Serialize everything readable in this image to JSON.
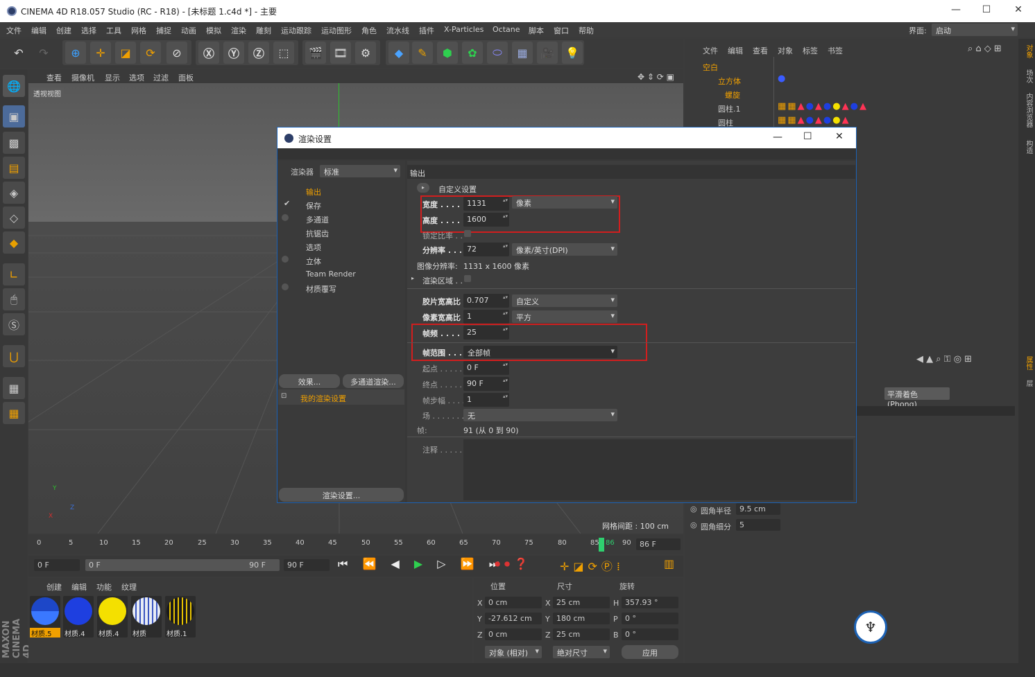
{
  "window": {
    "title": "CINEMA 4D R18.057 Studio (RC - R18) - [未标题 1.c4d *] - 主要",
    "controls": [
      "—",
      "☐",
      "✕"
    ]
  },
  "menu": {
    "items": [
      "文件",
      "编辑",
      "创建",
      "选择",
      "工具",
      "网格",
      "捕捉",
      "动画",
      "模拟",
      "渲染",
      "雕刻",
      "运动跟踪",
      "运动图形",
      "角色",
      "流水线",
      "插件",
      "X-Particles",
      "Octane",
      "脚本",
      "窗口",
      "帮助"
    ],
    "layout_label": "界面:",
    "layout_value": "启动"
  },
  "viewport": {
    "menu": [
      "查看",
      "摄像机",
      "显示",
      "选项",
      "过滤",
      "面板"
    ],
    "view_label": "透视视图",
    "grid_spacing": "网格间距 : 100 cm",
    "axis_y": "Y",
    "axis_z": "Z",
    "axis_x": "X"
  },
  "timeline": {
    "ticks": [
      "0",
      "5",
      "10",
      "15",
      "20",
      "25",
      "30",
      "35",
      "40",
      "45",
      "50",
      "55",
      "60",
      "65",
      "70",
      "75",
      "80",
      "85",
      "86",
      "90"
    ],
    "current_frame": "86 F",
    "start_field": "0 F",
    "range_start": "0 F",
    "range_end": "90 F",
    "end_field": "90 F"
  },
  "materials": {
    "menu": [
      "创建",
      "编辑",
      "功能",
      "纹理"
    ],
    "items": [
      {
        "label": "材质.5",
        "color": "#2a5bd7",
        "selected": true
      },
      {
        "label": "材质.4",
        "color": "#1e3fe0"
      },
      {
        "label": "材质.4",
        "color": "#f4e000"
      },
      {
        "label": "材质",
        "color": "#dfe4f0"
      },
      {
        "label": "材质.1",
        "color": "#1a1a1a"
      }
    ]
  },
  "coords": {
    "headers": [
      "位置",
      "尺寸",
      "旋转"
    ],
    "rows": [
      {
        "a": "X",
        "av": "0 cm",
        "b": "X",
        "bv": "25 cm",
        "c": "H",
        "cv": "357.93 °"
      },
      {
        "a": "Y",
        "av": "-27.612 cm",
        "b": "Y",
        "bv": "180 cm",
        "c": "P",
        "cv": "0 °"
      },
      {
        "a": "Z",
        "av": "0 cm",
        "b": "Z",
        "bv": "25 cm",
        "c": "B",
        "cv": "0 °"
      }
    ],
    "mode1": "对象 (相对)",
    "mode2": "绝对尺寸",
    "apply": "应用"
  },
  "objects": {
    "menu": [
      "文件",
      "编辑",
      "查看",
      "对象",
      "标签",
      "书签"
    ],
    "tree": [
      "空白",
      "立方体",
      "螺旋",
      "圆柱.1",
      "圆柱"
    ]
  },
  "attributes": {
    "phong": "平滑着色(Phong)",
    "fillet_radius_label": "圆角半径",
    "fillet_radius_value": "9.5 cm",
    "fillet_sub_label": "圆角细分",
    "fillet_sub_value": "5"
  },
  "righttabs": [
    "对象",
    "场次",
    "内容浏览器",
    "构造",
    "属性",
    "层"
  ],
  "brand": "MAXON CINEMA 4D",
  "dialog": {
    "title": "渲染设置",
    "renderer_label": "渲染器",
    "renderer_value": "标准",
    "nav": [
      "输出",
      "保存",
      "多通道",
      "抗锯齿",
      "选项",
      "立体",
      "Team Render",
      "材质覆写"
    ],
    "effects_button": "效果...",
    "multipass_button": "多通道渲染...",
    "my_settings": "我的渲染设置",
    "render_settings_button": "渲染设置...",
    "section": "输出",
    "custom": "自定义设置",
    "width_label": "宽度 . . . . .",
    "width_value": "1131",
    "width_unit": "像素",
    "height_label": "高度 . . . . .",
    "height_value": "1600",
    "lock_label": "锁定比率 . .",
    "resolution_label": "分辨率 . . . .",
    "resolution_value": "72",
    "resolution_unit": "像素/英寸(DPI)",
    "image_res_label": "图像分辨率:",
    "image_res_value": "1131 x 1600 像素",
    "region_label": "渲染区域 . .",
    "film_label": "胶片宽高比",
    "film_value": "0.707",
    "film_preset": "自定义",
    "pixel_label": "像素宽高比",
    "pixel_value": "1",
    "pixel_preset": "平方",
    "fps_label": "帧频 . . . . .",
    "fps_value": "25",
    "frange_label": "帧范围 . . . .",
    "frange_value": "全部帧",
    "start_label": "起点 . . . . .",
    "start_value": "0 F",
    "end_label": "终点 . . . . .",
    "end_value": "90 F",
    "step_label": "帧步幅 . . . .",
    "step_value": "1",
    "field_label": "场 . . . . . . .",
    "field_value": "无",
    "frames_label": "帧:",
    "frames_value": "91 (从 0 到 90)",
    "notes_label": "注释 . . . . ."
  }
}
